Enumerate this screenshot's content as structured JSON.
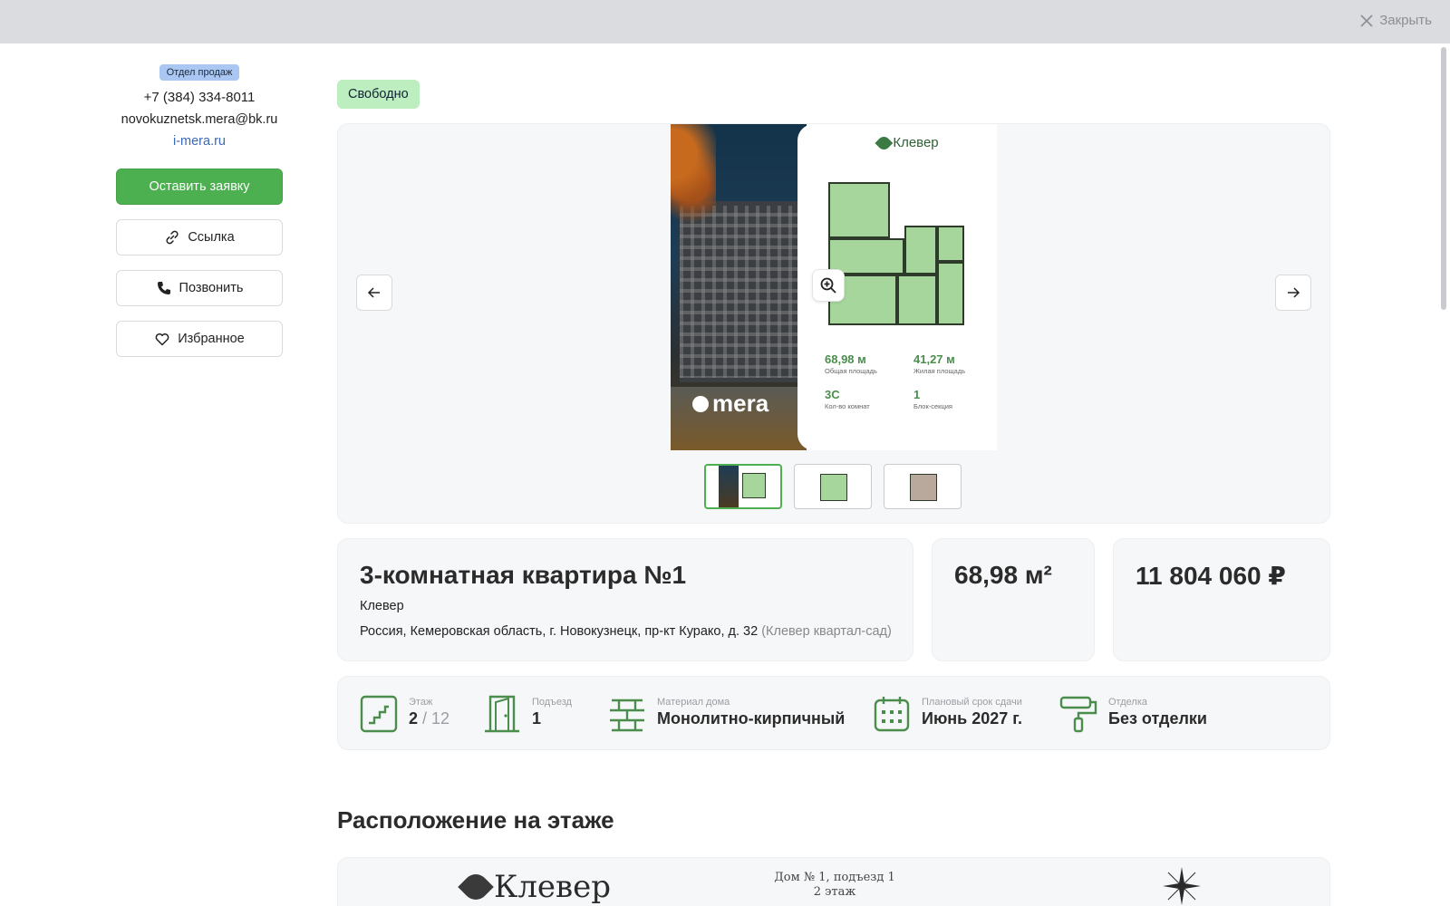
{
  "topbar": {
    "close_label": "Закрыть"
  },
  "sidebar": {
    "dept_badge": "Отдел продаж",
    "phone": "+7 (384) 334-8011",
    "email": "novokuznetsk.mera@bk.ru",
    "site": "i-mera.ru",
    "buttons": {
      "request": "Оставить заявку",
      "link": "Ссылка",
      "call": "Позвонить",
      "favorite": "Избранное"
    }
  },
  "status": "Свободно",
  "gallery": {
    "brand_logo": "mera",
    "complex_logo": "Клевер",
    "stats": [
      {
        "value": "68,98 м",
        "label": "Общая площадь"
      },
      {
        "value": "41,27 м",
        "label": "Жилая площадь"
      },
      {
        "value": "3С",
        "label": "Кол-во комнат"
      },
      {
        "value": "1",
        "label": "Блок-секция"
      }
    ]
  },
  "apartment": {
    "title": "3-комнатная квартира №1",
    "complex": "Клевер",
    "address": "Россия, Кемеровская область, г. Новокузнецк, пр-кт Курако, д. 32",
    "address_sub": "(Клевер квартал-сад)",
    "area": "68,98 м²",
    "price": "11 804 060 ₽"
  },
  "params": {
    "floor": {
      "label": "Этаж",
      "value": "2",
      "total": "/ 12"
    },
    "entrance": {
      "label": "Подъезд",
      "value": "1"
    },
    "material": {
      "label": "Материал дома",
      "value": "Монолитно-кирпичный"
    },
    "deadline": {
      "label": "Плановый срок сдачи",
      "value": "Июнь 2027 г."
    },
    "finish": {
      "label": "Отделка",
      "value": "Без отделки"
    }
  },
  "floor_section": {
    "title": "Расположение на этаже",
    "logo": "Клевер",
    "house_info": "Дом № 1, подъезд 1",
    "floor_info": "2 этаж"
  },
  "colors": {
    "accent": "#4caf50",
    "status_bg": "#bdeec0",
    "icon_green": "#4a8d4c"
  }
}
